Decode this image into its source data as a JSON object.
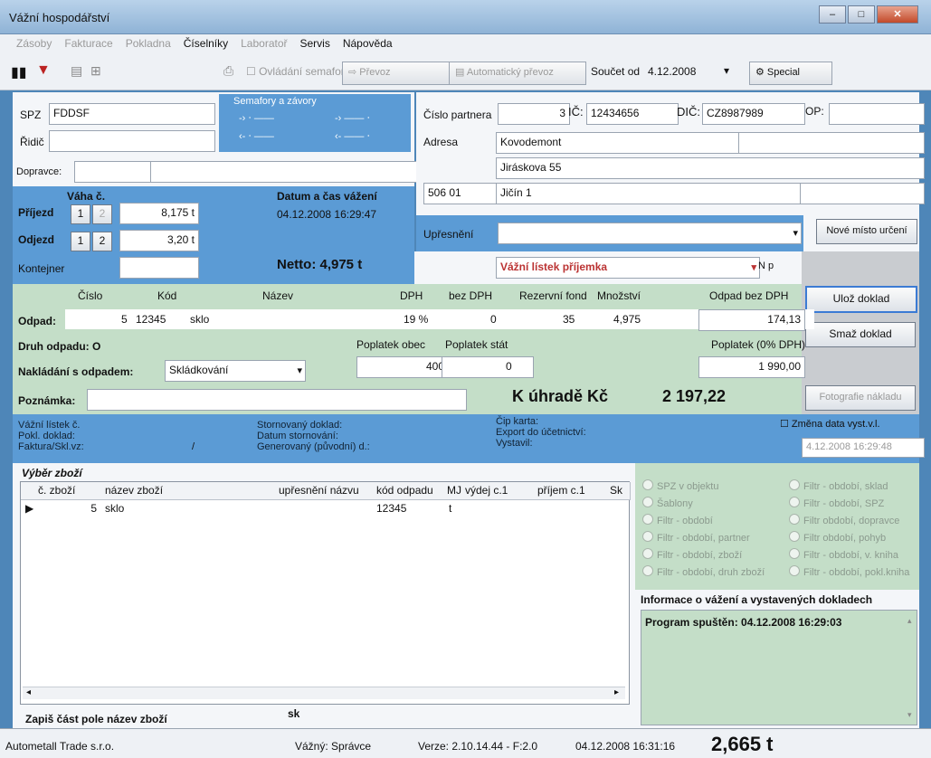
{
  "window": {
    "title": "Vážní hospodářství"
  },
  "menu": [
    "Zásoby",
    "Fakturace",
    "Pokladna",
    "Číselníky",
    "Laboratoř",
    "Servis",
    "Nápověda"
  ],
  "toolbar": {
    "semafor": "Ovládání semaforu",
    "prevoz": "Převoz",
    "auto": "Automatický převoz",
    "soucet_label": "Součet od",
    "soucet_value": "4.12.2008",
    "special": "Special"
  },
  "vehicle": {
    "spz_label": "SPZ",
    "spz_value": "FDDSF",
    "ridic_label": "Řidič",
    "ridic_value": "",
    "dopravce_label": "Dopravce:",
    "dopravce_value": "",
    "semafory_label": "Semafory a závory"
  },
  "partner": {
    "cislo_label": "Číslo partnera",
    "cislo_value": "3",
    "ic_label": "IČ:",
    "ic_value": "12434656",
    "dic_label": "DIČ:",
    "dic_value": "CZ8987989",
    "op_label": "OP:",
    "adresa_label": "Adresa",
    "line1": "Kovodemont",
    "line2": "Jiráskova 55",
    "psc": "506 01",
    "mesto": "Jičín 1",
    "upresneni_label": "Upřesnění",
    "nove_misto": "Nové místo určení"
  },
  "weighing": {
    "vaha_label": "Váha č.",
    "datum_label": "Datum a čas vážení",
    "datum_value": "04.12.2008 16:29:47",
    "prijezd_label": "Příjezd",
    "prijezd_value": "8,175 t",
    "odjezd_label": "Odjezd",
    "odjezd_value": "3,20 t",
    "n1": "1",
    "n2": "2",
    "kontejner_label": "Kontejner",
    "netto": "Netto: 4,975 t",
    "listek": "Vážní lístek příjemka",
    "np": "N p"
  },
  "waste": {
    "h_cislo": "Číslo",
    "h_kod": "Kód",
    "h_nazev": "Název",
    "h_dph": "DPH",
    "h_bezdph": "bez DPH",
    "h_rezerv": "Rezervní fond",
    "h_mnoz": "Množství",
    "h_odpad": "Odpad bez DPH",
    "odpad_label": "Odpad:",
    "cislo": "5",
    "kod": "12345",
    "nazev": "sklo",
    "dph": "19 %",
    "bezdph": "0",
    "rezerv": "35",
    "mnoz": "4,975",
    "odpad_bez": "174,13",
    "druh": "Druh odpadu: O",
    "obec_label": "Poplatek obec",
    "stat_label": "Poplatek stát",
    "popl0_label": "Poplatek (0% DPH)",
    "obec": "400",
    "stat": "0",
    "popl0": "1 990,00",
    "nakladani_label": "Nakládání s odpadem:",
    "nakladani_value": "Skládkování",
    "poznamka_label": "Poznámka:",
    "uhrade": "K úhradě Kč",
    "uhrade_value": "2 197,22"
  },
  "actions": {
    "uloz": "Ulož doklad",
    "smaz": "Smaž doklad",
    "foto": "Fotografie nákladu"
  },
  "info": {
    "listek": "Vážní lístek č.",
    "pokl": "Pokl. doklad:",
    "faktura": "Faktura/Skl.vz:",
    "slash": "/",
    "storno": "Stornovaný doklad:",
    "storno_datum": "Datum stornování:",
    "generovany": "Generovaný (původní) d.:",
    "cip": "Čip karta:",
    "export": "Export do účetnictví:",
    "vystavil": "Vystavil:",
    "zmena": "Změna data vyst.v.l.",
    "zmena_value": "4.12.2008  16:29:48"
  },
  "goods": {
    "title": "Výběr zboží",
    "headers": [
      "č. zboží",
      "název zboží",
      "upřesnění názvu",
      "kód odpadu",
      "MJ",
      "výdej c.1",
      "příjem c.1",
      "Sk"
    ],
    "row": {
      "cislo": "5",
      "nazev": "sklo",
      "kod": "12345",
      "mj": "t"
    },
    "filter_label": "Zapiš část pole název zboží",
    "filter_value": "sk"
  },
  "filters": {
    "left": [
      "SPZ v objektu",
      "Šablony",
      "Filtr - období",
      "Filtr - období, partner",
      "Filtr - období, zboží",
      "Filtr - období, druh zboží"
    ],
    "right": [
      "Filtr - období, sklad",
      "Filtr - období, SPZ",
      "Filtr období, dopravce",
      "Filtr období, pohyb",
      "Filtr - období, v. kniha",
      "Filtr - období, pokl.kniha"
    ]
  },
  "log": {
    "title": "Informace o vážení a vystavených dokladech",
    "line": "Program spuštěn: 04.12.2008 16:29:03"
  },
  "status": {
    "company": "Autometall Trade s.r.o.",
    "user": "Vážný: Správce",
    "version": "Verze: 2.10.14.44 - F:2.0",
    "datetime": "04.12.2008 16:31:16",
    "weight": "2,665 t"
  }
}
